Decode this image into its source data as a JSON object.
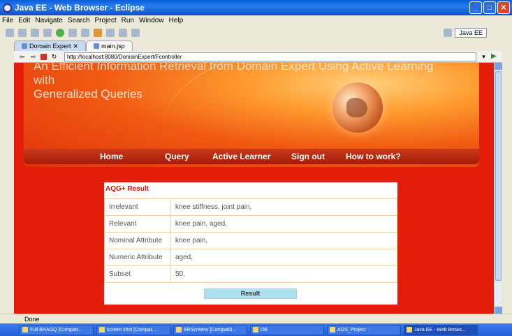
{
  "window": {
    "title": "Java EE - Web Browser - Eclipse"
  },
  "menubar": [
    "File",
    "Edit",
    "Navigate",
    "Search",
    "Project",
    "Run",
    "Window",
    "Help"
  ],
  "perspective": {
    "label": "Java EE"
  },
  "tabs": [
    {
      "label": "Domain Expert",
      "active": true
    },
    {
      "label": "main.jsp",
      "active": false
    }
  ],
  "browser": {
    "url": "http://localhost:8080/DomainExpert/Fcontroller"
  },
  "banner": {
    "title_line1": "An Efficient Information Retrieval from Domain Expert Using Active Learning with",
    "title_line2": "Generalized Queries"
  },
  "nav": [
    "Home",
    "Query",
    "Active Learner",
    "Sign out",
    "How to work?"
  ],
  "result": {
    "title": "AQG+ Result",
    "rows": [
      {
        "label": "Irrelevant",
        "value": "knee stiffness, joint pain,"
      },
      {
        "label": "Relevant",
        "value": "knee pain, aged,"
      },
      {
        "label": "Nominal Attribute",
        "value": "knee pain,"
      },
      {
        "label": "Numeric Attribute",
        "value": "aged,"
      },
      {
        "label": "Subset",
        "value": "50,"
      }
    ],
    "button_label": "Result"
  },
  "status": {
    "text": "Done"
  },
  "taskbar": [
    {
      "label": "Full BRAGQ [Compati..."
    },
    {
      "label": "screen shot [Compat..."
    },
    {
      "label": "BRScreens [Compatib..."
    },
    {
      "label": "DB"
    },
    {
      "label": "AGS_Project"
    },
    {
      "label": "Java EE - Web Brows..."
    }
  ],
  "colors": {
    "page_background": "#e41c0c",
    "result_title": "#d4170b",
    "result_button": "#aee0f0"
  }
}
